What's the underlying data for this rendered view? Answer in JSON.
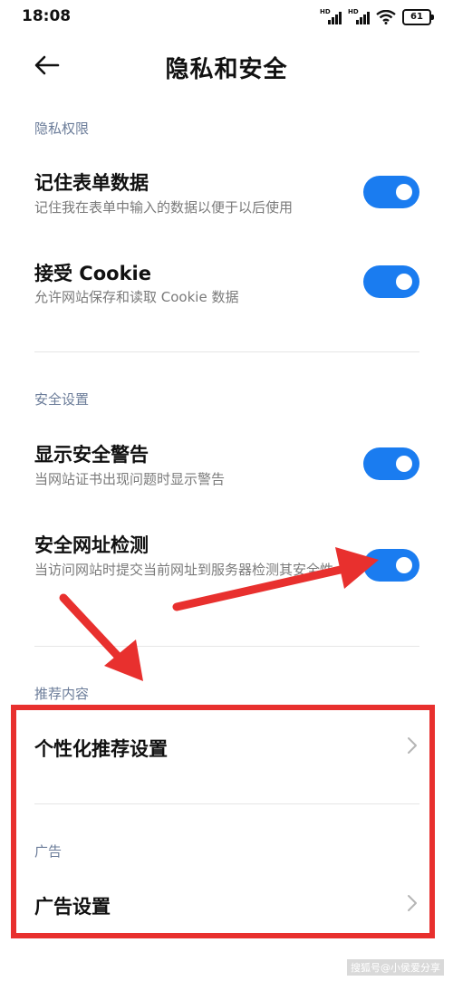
{
  "status_bar": {
    "time": "18:08",
    "signal1_label": "HD",
    "signal2_label": "HD",
    "battery": "61"
  },
  "header": {
    "title": "隐私和安全"
  },
  "privacy": {
    "label": "隐私权限",
    "items": [
      {
        "title": "记住表单数据",
        "subtitle": "记住我在表单中输入的数据以便于以后使用",
        "enabled": true
      },
      {
        "title": "接受 Cookie",
        "subtitle": "允许网站保存和读取 Cookie 数据",
        "enabled": true
      }
    ]
  },
  "security": {
    "label": "安全设置",
    "items": [
      {
        "title": "显示安全警告",
        "subtitle": "当网站证书出现问题时显示警告",
        "enabled": true
      },
      {
        "title": "安全网址检测",
        "subtitle": "当访问网站时提交当前网址到服务器检测其安全性",
        "enabled": true
      }
    ]
  },
  "recommend": {
    "label": "推荐内容",
    "item": "个性化推荐设置"
  },
  "ads": {
    "label": "广告",
    "item": "广告设置"
  },
  "watermark": "搜狐号@小侯爱分享",
  "colors": {
    "accent": "#1a7cf0",
    "annotation": "#e8302e"
  }
}
